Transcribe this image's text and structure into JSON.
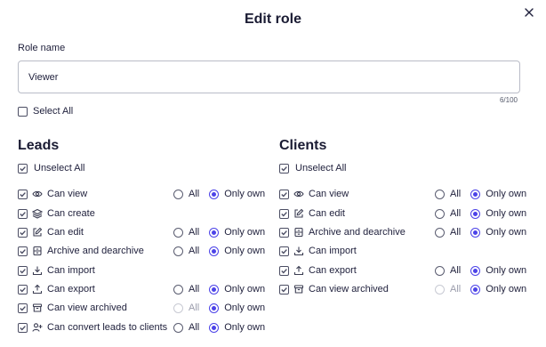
{
  "dialog": {
    "title": "Edit role"
  },
  "role": {
    "label": "Role name",
    "value": "Viewer",
    "counter": "6/100"
  },
  "select_all": {
    "label": "Select All"
  },
  "leads": {
    "heading": "Leads",
    "unselect_label": "Unselect All",
    "permissions": [
      {
        "label": "Can view",
        "icon": "eye-icon",
        "has_scope": true,
        "all_label": "All",
        "own_label": "Only own",
        "all_disabled": false
      },
      {
        "label": "Can create",
        "icon": "layers-icon",
        "has_scope": false
      },
      {
        "label": "Can edit",
        "icon": "edit-icon",
        "has_scope": true,
        "all_label": "All",
        "own_label": "Only own",
        "all_disabled": false
      },
      {
        "label": "Archive and dearchive",
        "icon": "archive-icon",
        "has_scope": true,
        "all_label": "All",
        "own_label": "Only own",
        "all_disabled": false
      },
      {
        "label": "Can import",
        "icon": "import-icon",
        "has_scope": false
      },
      {
        "label": "Can export",
        "icon": "export-icon",
        "has_scope": true,
        "all_label": "All",
        "own_label": "Only own",
        "all_disabled": false
      },
      {
        "label": "Can view archived",
        "icon": "archive-box-icon",
        "has_scope": true,
        "all_label": "All",
        "own_label": "Only own",
        "all_disabled": true
      },
      {
        "label": "Can convert leads to clients",
        "icon": "user-plus-icon",
        "has_scope": true,
        "all_label": "All",
        "own_label": "Only own",
        "all_disabled": false
      }
    ]
  },
  "clients": {
    "heading": "Clients",
    "unselect_label": "Unselect All",
    "permissions": [
      {
        "label": "Can view",
        "icon": "eye-icon",
        "has_scope": true,
        "all_label": "All",
        "own_label": "Only own",
        "all_disabled": false
      },
      {
        "label": "Can edit",
        "icon": "edit-icon",
        "has_scope": true,
        "all_label": "All",
        "own_label": "Only own",
        "all_disabled": false
      },
      {
        "label": "Archive and dearchive",
        "icon": "archive-icon",
        "has_scope": true,
        "all_label": "All",
        "own_label": "Only own",
        "all_disabled": false
      },
      {
        "label": "Can import",
        "icon": "import-icon",
        "has_scope": false
      },
      {
        "label": "Can export",
        "icon": "export-icon",
        "has_scope": true,
        "all_label": "All",
        "own_label": "Only own",
        "all_disabled": false
      },
      {
        "label": "Can view archived",
        "icon": "archive-box-icon",
        "has_scope": true,
        "all_label": "All",
        "own_label": "Only own",
        "all_disabled": true
      }
    ]
  },
  "colors": {
    "accent": "#4c43e8",
    "text": "#1e1f3b"
  }
}
